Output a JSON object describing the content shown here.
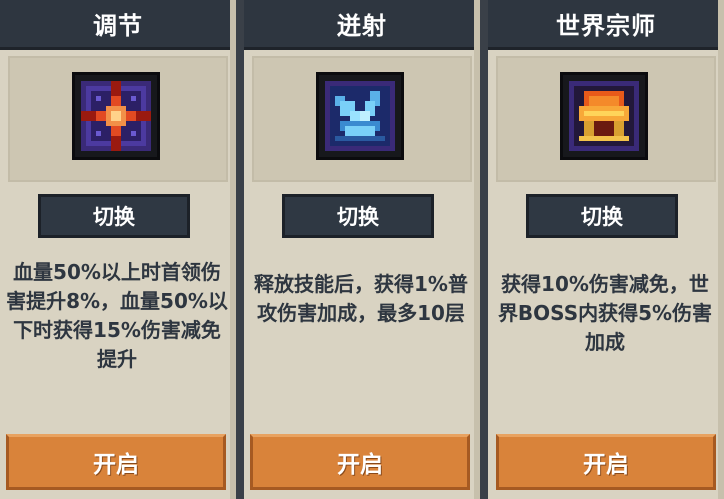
{
  "cards": [
    {
      "title": "调节",
      "icon": "cross-shield-icon",
      "switch_label": "切换",
      "description": "血量50%以上时首领伤害提升8%，血量50%以下时获得15%伤害减免提升",
      "open_label": "开启"
    },
    {
      "title": "迸射",
      "icon": "ice-shard-icon",
      "switch_label": "切换",
      "description": "释放技能后，获得1%普攻伤害加成，最多10层",
      "open_label": "开启"
    },
    {
      "title": "世界宗师",
      "icon": "fire-crown-icon",
      "switch_label": "切换",
      "description": "获得10%伤害减免，世界BOSS内获得5%伤害加成",
      "open_label": "开启"
    }
  ],
  "colors": {
    "title_bar": "#2e3640",
    "card_bg": "#d9d3c2",
    "button_dark": "#2f3843",
    "button_orange": "#d9833a"
  }
}
